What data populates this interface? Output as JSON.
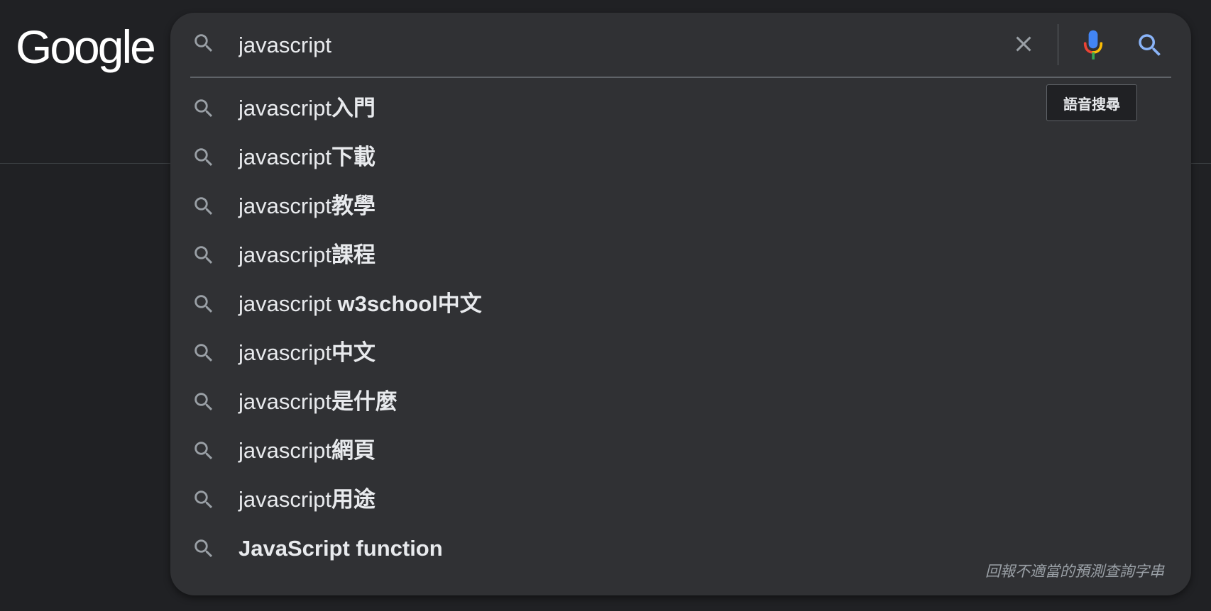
{
  "logo": {
    "text": "Google"
  },
  "search": {
    "query": "javascript",
    "mic_tooltip": "語音搜尋",
    "icons": {
      "lead": "search-icon",
      "clear": "close-icon",
      "mic": "microphone-icon",
      "submit": "search-icon"
    },
    "colors": {
      "mic_blue": "#4285f4",
      "mic_red": "#ea4335",
      "mic_yellow": "#fbbc04",
      "mic_green": "#34a853",
      "submit_blue": "#8ab4f8"
    }
  },
  "suggestions": [
    {
      "prefix": "javascript",
      "suffix": "入門"
    },
    {
      "prefix": "javascript",
      "suffix": "下載"
    },
    {
      "prefix": "javascript",
      "suffix": "教學"
    },
    {
      "prefix": "javascript",
      "suffix": "課程"
    },
    {
      "prefix": "javascript ",
      "suffix": "w3school中文"
    },
    {
      "prefix": "javascript",
      "suffix": "中文"
    },
    {
      "prefix": "javascript",
      "suffix": "是什麼"
    },
    {
      "prefix": "javascript",
      "suffix": "網頁"
    },
    {
      "prefix": "javascript",
      "suffix": "用途"
    },
    {
      "prefix": "",
      "suffix": "JavaScript function"
    }
  ],
  "report_link": "回報不適當的預測查詢字串"
}
